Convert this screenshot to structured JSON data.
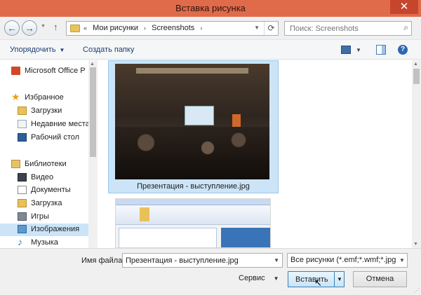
{
  "window": {
    "title": "Вставка рисунка",
    "close_glyph": "✕"
  },
  "nav": {
    "back_glyph": "←",
    "forward_glyph": "→",
    "history_glyph": "▼",
    "up_glyph": "↑",
    "breadcrumbs": [
      "«",
      "Мои рисунки",
      "›",
      "Screenshots",
      "›"
    ],
    "address_dropdown_glyph": "▼",
    "refresh_glyph": "⟳",
    "search_placeholder": "Поиск: Screenshots",
    "search_glyph": "⌕"
  },
  "commandbar": {
    "organize_label": "Упорядочить",
    "organize_arrow": "▼",
    "newfolder_label": "Создать папку",
    "view_dropdown_glyph": "▼",
    "help_glyph": "?"
  },
  "sidebar": {
    "items": [
      {
        "label": "Microsoft Office P",
        "icon": "office-icon"
      },
      {
        "label": "Избранное",
        "icon": "star-icon",
        "glyph": "★"
      },
      {
        "label": "Загрузки",
        "icon": "downloads-icon"
      },
      {
        "label": "Недавние места",
        "icon": "recent-places-icon"
      },
      {
        "label": "Рабочий стол",
        "icon": "desktop-icon"
      },
      {
        "label": "Библиотеки",
        "icon": "libraries-icon"
      },
      {
        "label": "Видео",
        "icon": "video-icon"
      },
      {
        "label": "Документы",
        "icon": "documents-icon"
      },
      {
        "label": "Загрузка",
        "icon": "downloads-icon"
      },
      {
        "label": "Игры",
        "icon": "games-icon"
      },
      {
        "label": "Изображения",
        "icon": "pictures-icon",
        "selected": true
      },
      {
        "label": "Музыка",
        "icon": "music-icon",
        "glyph": "♪"
      }
    ],
    "scroll_up_glyph": "▲"
  },
  "files": [
    {
      "name": "Презентация - выступление.jpg",
      "selected": true
    },
    {
      "name": "",
      "selected": false
    }
  ],
  "content_scroll": {
    "up_glyph": "▲",
    "down_glyph": "▼"
  },
  "footer": {
    "filename_label": "Имя файла:",
    "filename_value": "Презентация - выступление.jpg",
    "filename_dropdown_glyph": "▼",
    "filter_value": "Все рисунки (*.emf;*.wmf;*.jpg",
    "filter_dropdown_glyph": "▼",
    "tools_label": "Сервис",
    "tools_arrow": "▼",
    "insert_label": "Вставить",
    "insert_dropdown_glyph": "▼",
    "cursor_glyph": "↖",
    "cancel_label": "Отмена",
    "grip_glyph": "⋰"
  },
  "colors": {
    "titlebar": "#e06b4b",
    "selection": "#cce4f7",
    "link_text": "#1e3e6e"
  }
}
